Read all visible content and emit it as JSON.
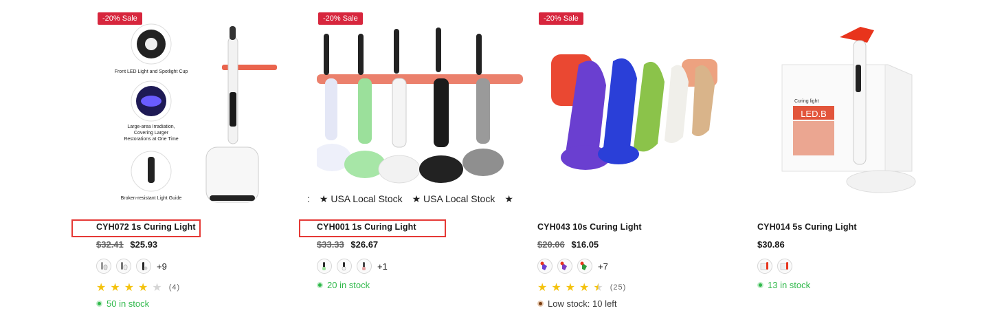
{
  "products": [
    {
      "badge": "-20% Sale",
      "features": [
        "Front LED Light and Spotlight Cup",
        "Large-area Irradiation,",
        "Covering Larger",
        "Restorations at One Time",
        "Broken-resistant Light Guide"
      ],
      "title": "CYH072 1s Curing Light",
      "old_price": "$32.41",
      "price": "$25.93",
      "more_swatches": "+9",
      "rating": 4,
      "review_count": "(4)",
      "stock": "50 in stock",
      "highlighted": true
    },
    {
      "badge": "-20% Sale",
      "marquee": [
        ": ",
        "★ USA Local Stock",
        "★ USA Local Stock",
        "★"
      ],
      "title": "CYH001 1s Curing Light",
      "old_price": "$33.33",
      "price": "$26.67",
      "more_swatches": "+1",
      "stock": "20 in stock",
      "highlighted": true
    },
    {
      "badge": "-20% Sale",
      "title": "CYH043 10s Curing Light",
      "old_price": "$20.06",
      "price": "$16.05",
      "more_swatches": "+7",
      "rating": 4.5,
      "review_count": "(25)",
      "stock": "Low stock: 10 left"
    },
    {
      "box_text": {
        "label": "Curing light",
        "brand": "LED.B"
      },
      "title": "CYH014 5s Curing Light",
      "price": "$30.86",
      "stock": "13 in stock"
    }
  ],
  "colors": {
    "sale": "#d7263d",
    "in_stock": "#2fb84a",
    "low_stock": "#7a3e12",
    "star": "#f4c20d",
    "highlight": "#e53935"
  }
}
